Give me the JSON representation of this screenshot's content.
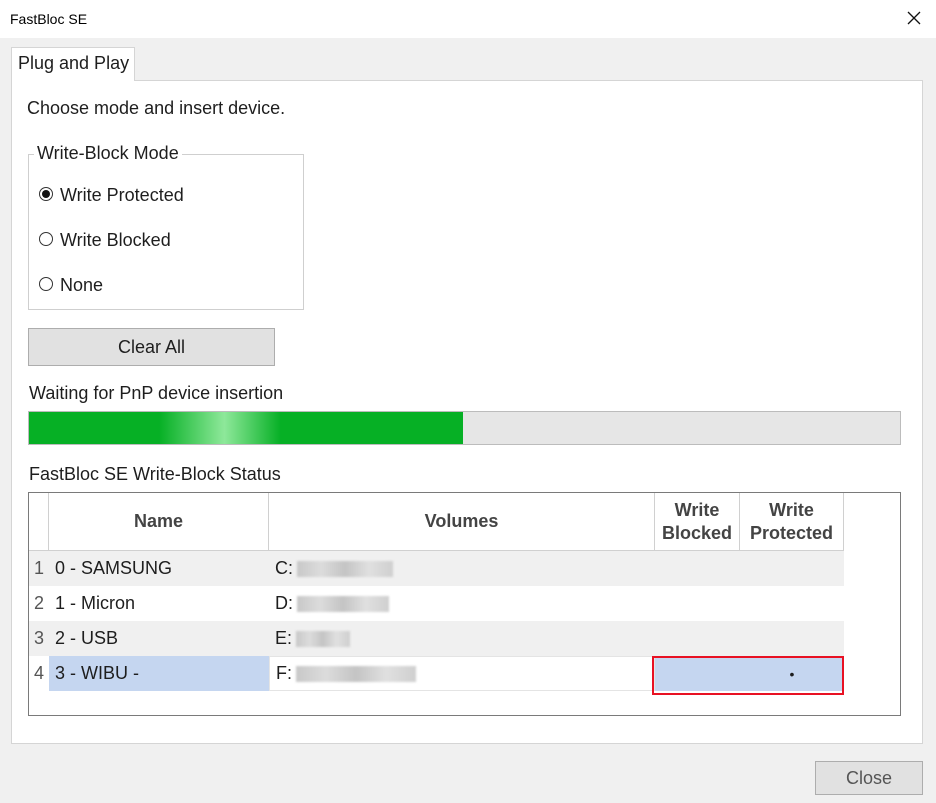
{
  "window": {
    "title": "FastBloc SE"
  },
  "tabs": [
    {
      "label": "Plug and Play"
    }
  ],
  "instructions": "Choose mode and insert device.",
  "write_block_mode": {
    "title": "Write-Block Mode",
    "options": [
      {
        "label": "Write Protected",
        "checked": true
      },
      {
        "label": "Write Blocked",
        "checked": false
      },
      {
        "label": "None",
        "checked": false
      }
    ]
  },
  "clear_all_label": "Clear All",
  "status_text": "Waiting for PnP device insertion",
  "progress": {
    "fraction": 0.498,
    "color": "#06b025"
  },
  "table": {
    "title": "FastBloc SE Write-Block Status",
    "columns": [
      "Name",
      "Volumes",
      "Write Blocked",
      "Write Protected"
    ],
    "rows": [
      {
        "num": "1",
        "name": "0 - SAMSUNG",
        "volume": "C:",
        "write_blocked": "",
        "write_protected": ""
      },
      {
        "num": "2",
        "name": "1 - Micron",
        "volume": "D:",
        "write_blocked": "",
        "write_protected": ""
      },
      {
        "num": "3",
        "name": "2 - USB",
        "volume": "E:",
        "write_blocked": "",
        "write_protected": ""
      },
      {
        "num": "4",
        "name": "3 - WIBU -",
        "volume": "F:",
        "write_blocked": "",
        "write_protected": "•"
      }
    ],
    "selected_row": 3
  },
  "close_label": "Close",
  "colors": {
    "selection": "#c5d6f0",
    "alt_row": "#f0f0f0",
    "highlight_border": "#e81123"
  }
}
